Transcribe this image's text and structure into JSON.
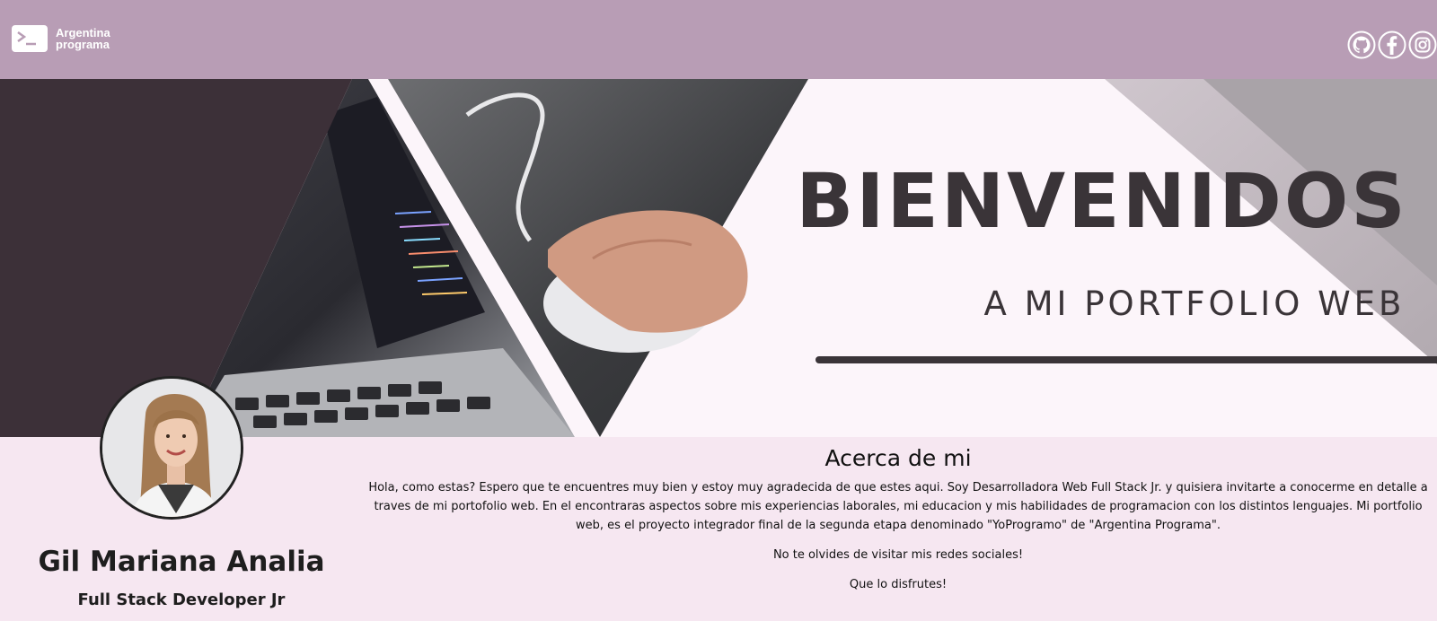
{
  "header": {
    "logo_line1": "Argentina",
    "logo_line2": "programa",
    "background_color": "#b89db5",
    "social_icons": [
      "github-icon",
      "facebook-icon",
      "instagram-icon"
    ]
  },
  "banner": {
    "title": "BIENVENIDOS",
    "subtitle": "A MI PORTFOLIO WEB"
  },
  "profile": {
    "name": "Gil Mariana Analia",
    "role": "Full Stack Developer Jr"
  },
  "about": {
    "heading": "Acerca de mi",
    "paragraph": "Hola, como estas? Espero que te encuentres muy bien y estoy muy agradecida de que estes aqui. Soy Desarrolladora Web Full Stack Jr. y quisiera invitarte a conocerme en detalle a traves de mi portofolio web. En el encontraras aspectos sobre mis experiencias laborales, mi educacion y mis habilidades de programacion con los distintos lenguajes. Mi portfolio web, es el proyecto integrador final de la segunda etapa denominado \"YoProgramo\" de \"Argentina Programa\".",
    "line2": "No te olvides de visitar mis redes sociales!",
    "line3": "Que lo disfrutes!"
  },
  "colors": {
    "page_background": "#f6e7f1",
    "banner_text": "#3a3438",
    "dark_panel": "#3c3038"
  }
}
